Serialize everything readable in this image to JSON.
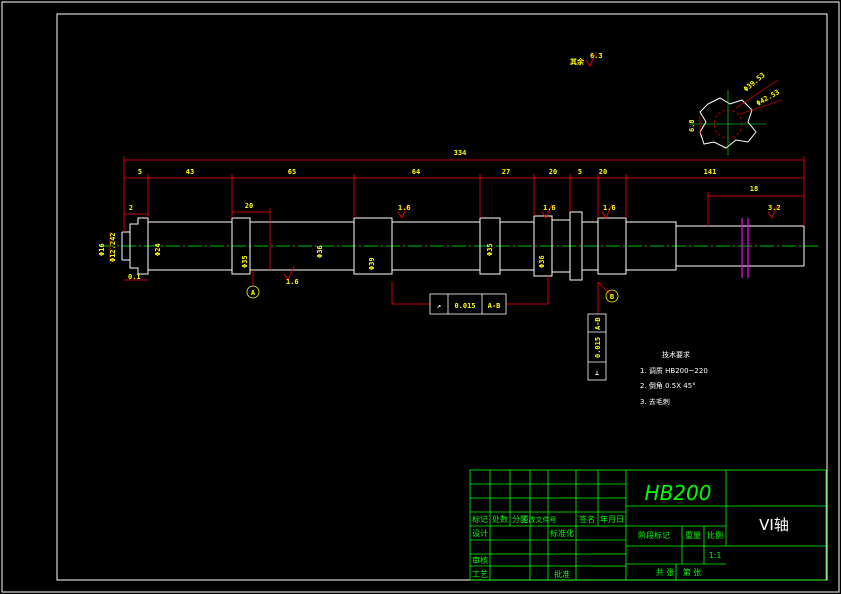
{
  "overall_length": "334",
  "dims_top": [
    "5",
    "43",
    "65",
    "64",
    "27",
    "20",
    "5",
    "20",
    "141",
    "18"
  ],
  "dims_lower": [
    "2",
    "20"
  ],
  "diameters": [
    "Φ12.242",
    "Φ24",
    "Φ35",
    "Φ36",
    "Φ39",
    "Φ35",
    "Φ36"
  ],
  "left_dims": [
    "Φ16",
    "0.1"
  ],
  "roughness": [
    "1.6",
    "1.6",
    "1.6",
    "1.6",
    "3.2",
    "6.3"
  ],
  "roughness_other": "其余",
  "roughness_other_value": "6.3",
  "datum_a": "A",
  "datum_b": "B",
  "runout_frame": {
    "symbol": "↗",
    "value": "0.015",
    "datum": "A-B"
  },
  "perp_frame": {
    "symbol": "⊥",
    "value": "0.015",
    "datum": "A-B"
  },
  "spline_labels": [
    "Φ39.53",
    "Φ42.53",
    "6.8"
  ],
  "notes": {
    "title": "技术要求",
    "items": [
      "1. 调质 HB200~220",
      "2. 倒角 0.5X 45°",
      "3. 去毛刺"
    ]
  },
  "title_block": {
    "material": "HB200",
    "part_name": "VI轴",
    "header_cells": [
      "标记",
      "处数",
      "分区",
      "更改文件号",
      "签名",
      "年月日"
    ],
    "row_labels": [
      "设计",
      "审核",
      "工艺"
    ],
    "std_label": "标准化",
    "approve_label": "批准",
    "stage_label": "阶段标记",
    "weight_label": "重量",
    "scale_label": "比例",
    "scale_value": "1:1",
    "sheets_label": "共 张",
    "sheet_label": "第 张"
  }
}
